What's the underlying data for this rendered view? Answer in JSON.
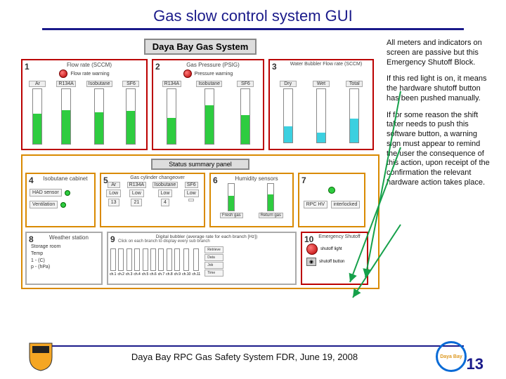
{
  "title": "Gas slow control system GUI",
  "gui": {
    "system_title": "Daya Bay Gas System",
    "status_banner": "Status summary panel",
    "panel1": {
      "title": "Flow rate (SCCM)",
      "led_label": "Flow rate\nwarning",
      "cols": [
        "Ar",
        "R134A",
        "Isobutane",
        "SF6"
      ]
    },
    "panel2": {
      "title": "Gas Pressure (PSIG)",
      "led_label": "Pressure\nwarning",
      "cols": [
        "R134A",
        "Isobutane",
        "SF6"
      ]
    },
    "panel3": {
      "title": "Water Bubbler Flow rate (SCCM)",
      "cols": [
        "Dry",
        "Wet",
        "Total"
      ]
    },
    "panel4": {
      "title": "Isobutane cabinet",
      "rows": [
        "HAD sensor",
        "Ventilation"
      ]
    },
    "panel5": {
      "title": "Gas cylinder changeover",
      "cols": [
        "Ar",
        "R134A",
        "Isobutane",
        "SF6"
      ],
      "vals": [
        "Low",
        "Low",
        "Low",
        "Low"
      ],
      "nums": [
        "13",
        "21",
        "4",
        ""
      ]
    },
    "panel6": {
      "title": "Humidity sensors",
      "cols": [
        "Fresh gas",
        "Return gas"
      ]
    },
    "panel7": {
      "title": "",
      "line1": "RPC HV",
      "line2": "interlocked"
    },
    "panel8": {
      "title": "Weather station",
      "rows": [
        "Storage room",
        "Temp",
        "1 - (C)",
        "p - (hPa)"
      ]
    },
    "panel9": {
      "title": "Digital bubbler (average rate for each branch [Hz])",
      "sub": "Click on each branch to display every sub branch",
      "cols": [
        "ch.1",
        "ch.2",
        "ch.3",
        "ch.4",
        "ch.5",
        "ch.6",
        "ch.7",
        "ch.8",
        "ch.9",
        "ch.10",
        "ch.11"
      ],
      "side": [
        "Retrieve",
        "Data",
        "Job",
        "Time"
      ]
    },
    "panel10": {
      "title": "Emergency Shutoff",
      "led_label": "shutoff light",
      "button": "shutoff button"
    }
  },
  "notes": {
    "p1": "All meters and indicators on screen are passive but this Emergency Shutoff Block.",
    "p2": "If this red light is on, it means the hardware shutoff button has been pushed manually.",
    "p3": "If for some reason the shift taker needs to push this software button, a warning sign must appear to remind the user the consequence of this action, upon receipt of the confirmation the relevant hardware action takes place."
  },
  "footer": {
    "text": "Daya Bay RPC Gas Safety System FDR, June 19, 2008",
    "page": "13",
    "logo": "Daya Bay"
  }
}
